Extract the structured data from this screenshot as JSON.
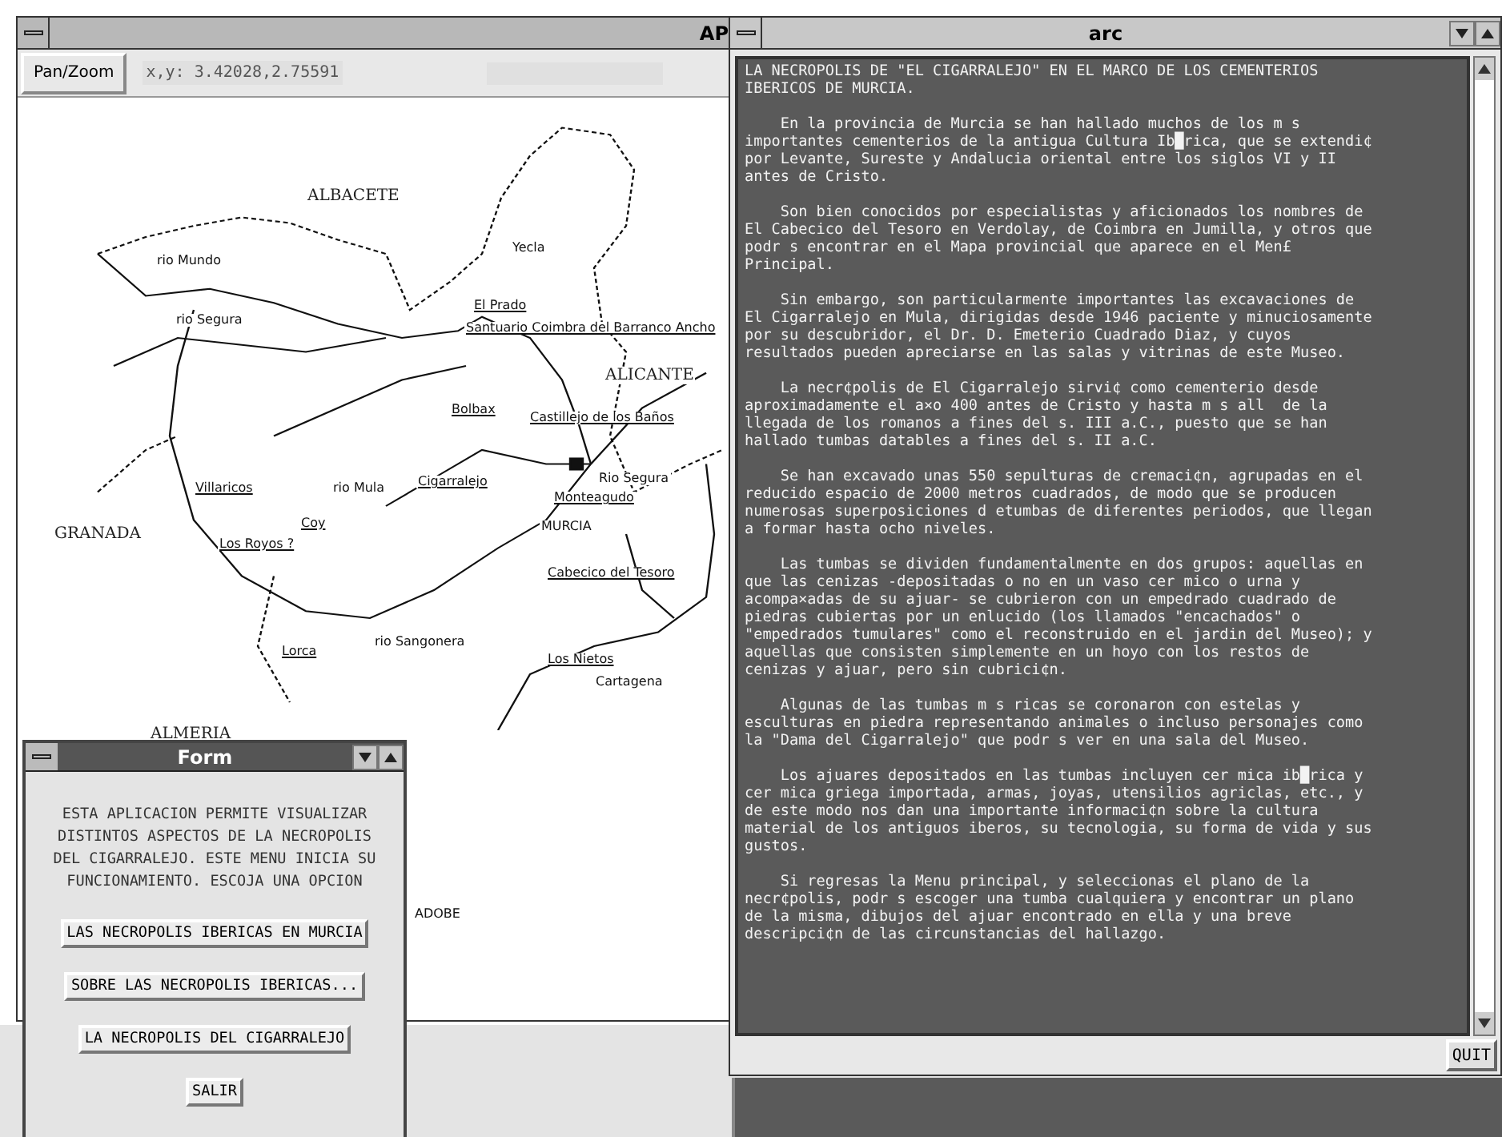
{
  "map_window": {
    "title": "AP",
    "pan_zoom_button": "Pan/Zoom",
    "coordinates": "x,y: 3.42028,2.75591",
    "map_labels": [
      {
        "text": "ALBACETE",
        "kind": "region"
      },
      {
        "text": "rio Mundo",
        "kind": "river"
      },
      {
        "text": "rio Segura",
        "kind": "river"
      },
      {
        "text": "Yecla",
        "kind": "town"
      },
      {
        "text": "El Prado",
        "kind": "site"
      },
      {
        "text": "Santuario Coimbra del Barranco Ancho",
        "kind": "site"
      },
      {
        "text": "ALICANTE",
        "kind": "region"
      },
      {
        "text": "Bolbax",
        "kind": "site"
      },
      {
        "text": "Castillejo de los Baños",
        "kind": "site"
      },
      {
        "text": "Villaricos",
        "kind": "site"
      },
      {
        "text": "rio Mula",
        "kind": "river"
      },
      {
        "text": "Cigarralejo",
        "kind": "site"
      },
      {
        "text": "Monteagudo",
        "kind": "site"
      },
      {
        "text": "Rio Segura",
        "kind": "river"
      },
      {
        "text": "GRANADA",
        "kind": "region"
      },
      {
        "text": "Coy",
        "kind": "site"
      },
      {
        "text": "MURCIA",
        "kind": "town"
      },
      {
        "text": "Los Royos ?",
        "kind": "site"
      },
      {
        "text": "Cabecico del Tesoro",
        "kind": "site"
      },
      {
        "text": "Lorca",
        "kind": "site"
      },
      {
        "text": "rio Sangonera",
        "kind": "river"
      },
      {
        "text": "Los Nietos",
        "kind": "site"
      },
      {
        "text": "Cartagena",
        "kind": "town"
      },
      {
        "text": "ALMERIA",
        "kind": "region"
      },
      {
        "text": "ADOBE",
        "kind": "town"
      }
    ]
  },
  "text_window": {
    "title": "arc",
    "quit_button": "QUIT",
    "paragraphs": [
      {
        "indented": false,
        "lines": [
          "LA NECROPOLIS DE \"EL CIGARRALEJO\" EN EL MARCO DE LOS CEMENTERIOS",
          "IBERICOS DE MURCIA."
        ]
      },
      {
        "indented": true,
        "lines": [
          "En la provincia de Murcia se han hallado muchos de los m s",
          "importantes cementerios de la antigua Cultura Ib█rica, que se extendi¢",
          "por Levante, Sureste y Andalucia oriental entre los siglos VI y II",
          "antes de Cristo."
        ]
      },
      {
        "indented": true,
        "lines": [
          "Son bien conocidos por especialistas y aficionados los nombres de",
          "El Cabecico del Tesoro en Verdolay, de Coimbra en Jumilla, y otros que",
          "podr s encontrar en el Mapa provincial que aparece en el Men£",
          "Principal."
        ]
      },
      {
        "indented": true,
        "lines": [
          "Sin embargo, son particularmente importantes las excavaciones de",
          "El Cigarralejo en Mula, dirigidas desde 1946 paciente y minuciosamente",
          "por su descubridor, el Dr. D. Emeterio Cuadrado Diaz, y cuyos",
          "resultados pueden apreciarse en las salas y vitrinas de este Museo."
        ]
      },
      {
        "indented": true,
        "lines": [
          "La necr¢polis de El Cigarralejo sirvi¢ como cementerio desde",
          "aproximadamente el a×o 400 antes de Cristo y hasta m s all  de la",
          "llegada de los romanos a fines del s. III a.C., puesto que se han",
          "hallado tumbas datables a fines del s. II a.C."
        ]
      },
      {
        "indented": true,
        "lines": [
          "Se han excavado unas 550 sepulturas de cremaci¢n, agrupadas en el",
          "reducido espacio de 2000 metros cuadrados, de modo que se producen",
          "numerosas superposiciones d etumbas de diferentes periodos, que llegan",
          "a formar hasta ocho niveles."
        ]
      },
      {
        "indented": true,
        "lines": [
          "Las tumbas se dividen fundamentalmente en dos grupos: aquellas en",
          "que las cenizas -depositadas o no en un vaso cer mico o urna y",
          "acompa×adas de su ajuar- se cubrieron con un empedrado cuadrado de",
          "piedras cubiertas por un enlucido (los llamados \"encachados\" o",
          "\"empedrados tumulares\" como el reconstruido en el jardin del Museo); y",
          "aquellas que consisten simplemente en un hoyo con los restos de",
          "cenizas y ajuar, pero sin cubrici¢n."
        ]
      },
      {
        "indented": true,
        "lines": [
          "Algunas de las tumbas m s ricas se coronaron con estelas y",
          "esculturas en piedra representando animales o incluso personajes como",
          "la \"Dama del Cigarralejo\" que podr s ver en una sala del Museo."
        ]
      },
      {
        "indented": true,
        "lines": [
          "Los ajuares depositados en las tumbas incluyen cer mica ib█rica y",
          "cer mica griega importada, armas, joyas, utensilios agriclas, etc., y",
          "de este modo nos dan una importante informaci¢n sobre la cultura",
          "material de los antiguos iberos, su tecnologia, su forma de vida y sus",
          "gustos."
        ]
      },
      {
        "indented": true,
        "lines": [
          "Si regresas la Menu principal, y seleccionas el plano de la",
          "necr¢polis, podr s escoger una tumba cualquiera y encontrar un plano",
          "de la misma, dibujos del ajuar encontrado en ella y una breve",
          "descripci¢n de las circunstancias del hallazgo."
        ]
      }
    ]
  },
  "form_window": {
    "title": "Form",
    "intro_lines": [
      "ESTA APLICACION PERMITE VISUALIZAR",
      "DISTINTOS ASPECTOS DE LA NECROPOLIS",
      "DEL CIGARRALEJO. ESTE MENU INICIA SU",
      "FUNCIONAMIENTO. ESCOJA UNA OPCION"
    ],
    "buttons": [
      "LAS NECROPOLIS IBERICAS EN MURCIA",
      "SOBRE LAS NECROPOLIS IBERICAS...",
      "LA NECROPOLIS DEL CIGARRALEJO",
      "SALIR"
    ]
  }
}
